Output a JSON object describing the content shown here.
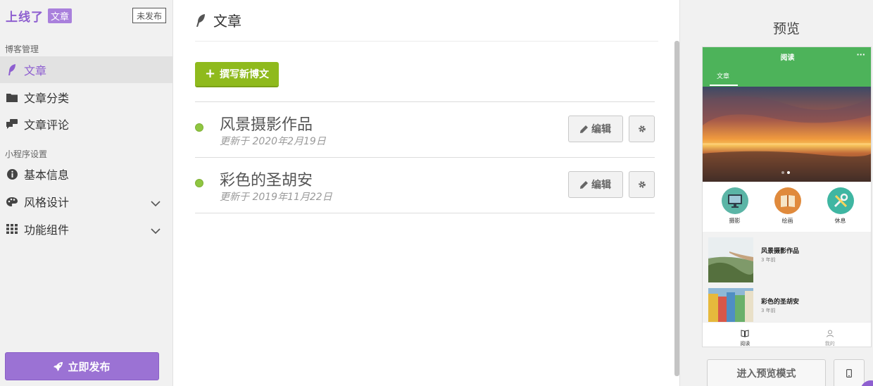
{
  "brand": {
    "name": "上线了",
    "tag": "文章",
    "status": "未发布"
  },
  "sidebar": {
    "sections": [
      {
        "label": "博客管理"
      },
      {
        "label": "小程序设置"
      }
    ],
    "items": [
      {
        "label": "文章",
        "icon": "feather-icon",
        "active": true
      },
      {
        "label": "文章分类",
        "icon": "folder-icon"
      },
      {
        "label": "文章评论",
        "icon": "comments-icon"
      },
      {
        "label": "基本信息",
        "icon": "info-icon"
      },
      {
        "label": "风格设计",
        "icon": "palette-icon",
        "expandable": true
      },
      {
        "label": "功能组件",
        "icon": "grid-icon",
        "expandable": true
      }
    ],
    "publish_label": "立即发布"
  },
  "main": {
    "title": "文章",
    "new_post_label": "撰写新博文",
    "posts": [
      {
        "title": "风景摄影作品",
        "updated": "更新于 2020年2月19日",
        "edit_label": "编辑",
        "status_color": "#8fc641"
      },
      {
        "title": "彩色的圣胡安",
        "updated": "更新于 2019年11月22日",
        "edit_label": "编辑",
        "status_color": "#8fc641"
      }
    ]
  },
  "preview": {
    "title": "预览",
    "phone": {
      "nav_title": "阅读",
      "more": "···",
      "tab": "文章",
      "features": [
        {
          "label": "摄影",
          "icon": "monitor-icon",
          "color": "#5bb5a6"
        },
        {
          "label": "绘画",
          "icon": "book-icon",
          "color": "#e08a3c"
        },
        {
          "label": "休息",
          "icon": "tools-icon",
          "color": "#3fb6a2"
        }
      ],
      "articles": [
        {
          "title": "风景摄影作品",
          "time": "3 年前"
        },
        {
          "title": "彩色的圣胡安",
          "time": "3 年前"
        }
      ],
      "tabbar": [
        {
          "label": "阅读",
          "icon": "book-open-icon"
        },
        {
          "label": "我的",
          "icon": "user-icon"
        }
      ]
    },
    "preview_mode_label": "进入预览模式"
  },
  "colors": {
    "brand": "#8e5fd0",
    "accent_green": "#8fba1d",
    "phone_green": "#4db35a"
  }
}
